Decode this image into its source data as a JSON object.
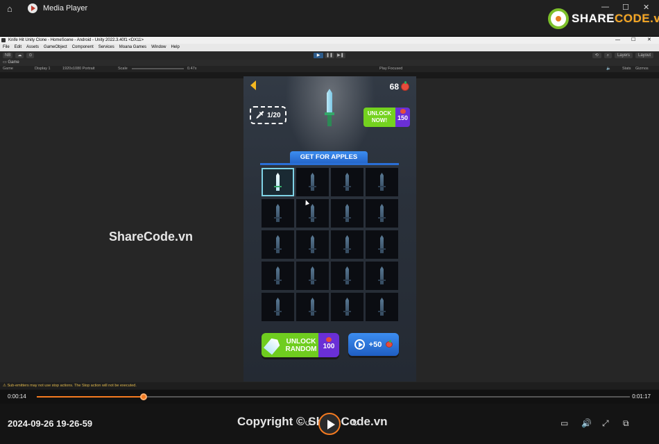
{
  "player": {
    "title": "Media Player",
    "logo_share": "SHARE",
    "logo_code": "CODE.vn",
    "current_time": "0:00:14",
    "total_time": "0:01:17",
    "progress_fraction": 0.18,
    "timestamp": "2024-09-26 19-26-59",
    "copyright": "Copyright © ShareCode.vn",
    "accent": "#f47a20"
  },
  "unity": {
    "window_title": "Knife Hit Unity Clone - HomeScene - Android - Unity 2022.3.40f1 <DX11>",
    "menu": [
      "File",
      "Edit",
      "Assets",
      "GameObject",
      "Component",
      "Services",
      "Moana Games",
      "Window",
      "Help"
    ],
    "toolbar_left": [
      "NB",
      "☁",
      "⊙"
    ],
    "toolbar_right": [
      "Layers",
      "Layout"
    ],
    "tab": "Game",
    "game_bar": {
      "mode": "Game",
      "display": "Display 1",
      "resolution": "1920x1080 Portrait",
      "scale_label": "Scale",
      "scale_value": "0.47x",
      "play_focused": "Play Focused",
      "stats": "Stats",
      "gizmos": "Gizmos"
    },
    "status": "⚠ Sub-emitters may not use stop actions. The Stop action will not be executed.",
    "watermark": "ShareCode.vn"
  },
  "game": {
    "apple_count": "68",
    "knife_counter": "1/20",
    "unlock_now_label": "UNLOCK NOW!",
    "unlock_now_price": "150",
    "banner": "GET FOR APPLES",
    "selected_index": 0,
    "grid_rows": 5,
    "grid_cols": 4,
    "random_label": "UNLOCK RANDOM",
    "random_price": "100",
    "ad_reward": "+50"
  }
}
